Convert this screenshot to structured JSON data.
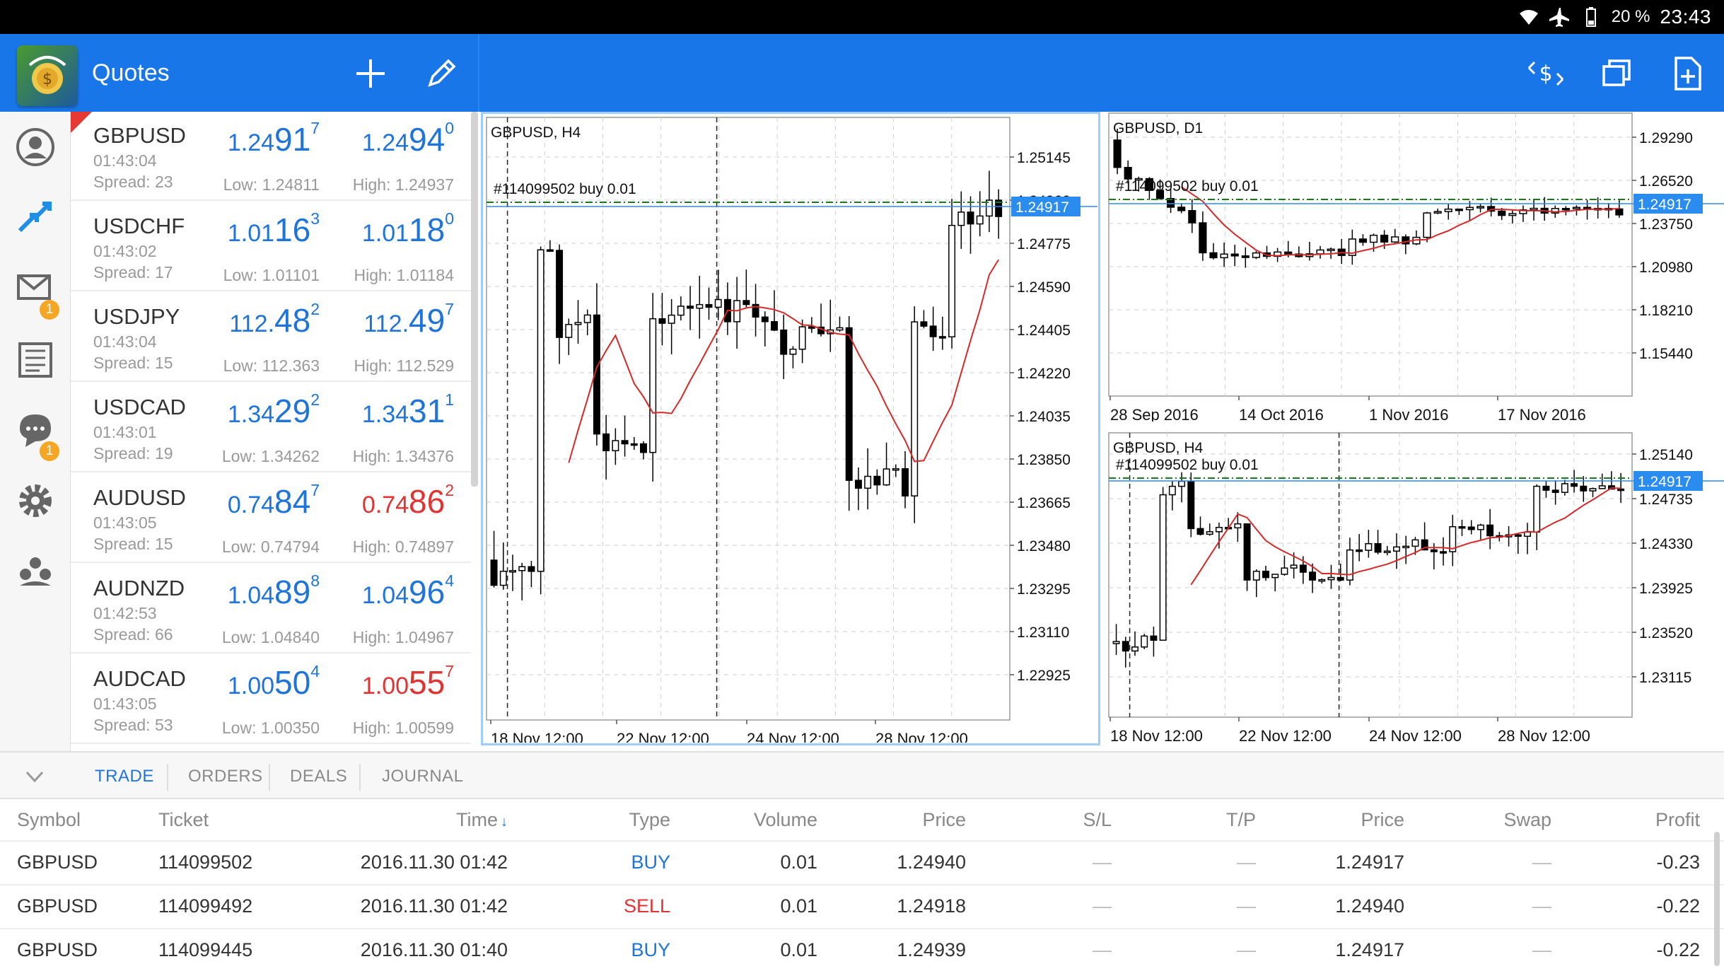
{
  "status_bar": {
    "battery": "20 %",
    "time": "23:43"
  },
  "toolbar": {
    "title": "Quotes"
  },
  "nav": {
    "mail_badge": "1",
    "chat_badge": "1"
  },
  "quotes": [
    {
      "symbol": "GBPUSD",
      "time": "01:43:04",
      "spread": "Spread: 23",
      "bid_a": "1.24",
      "bid_b": "91",
      "bid_c": "7",
      "bid_dir": "up",
      "ask_a": "1.24",
      "ask_b": "94",
      "ask_c": "0",
      "ask_dir": "up",
      "low": "Low: 1.24811",
      "high": "High: 1.24937",
      "flag": true
    },
    {
      "symbol": "USDCHF",
      "time": "01:43:02",
      "spread": "Spread: 17",
      "bid_a": "1.01",
      "bid_b": "16",
      "bid_c": "3",
      "bid_dir": "up",
      "ask_a": "1.01",
      "ask_b": "18",
      "ask_c": "0",
      "ask_dir": "up",
      "low": "Low: 1.01101",
      "high": "High: 1.01184"
    },
    {
      "symbol": "USDJPY",
      "time": "01:43:04",
      "spread": "Spread: 15",
      "bid_a": "112.",
      "bid_b": "48",
      "bid_c": "2",
      "bid_dir": "up",
      "ask_a": "112.",
      "ask_b": "49",
      "ask_c": "7",
      "ask_dir": "up",
      "low": "Low: 112.363",
      "high": "High: 112.529"
    },
    {
      "symbol": "USDCAD",
      "time": "01:43:01",
      "spread": "Spread: 19",
      "bid_a": "1.34",
      "bid_b": "29",
      "bid_c": "2",
      "bid_dir": "up",
      "ask_a": "1.34",
      "ask_b": "31",
      "ask_c": "1",
      "ask_dir": "up",
      "low": "Low: 1.34262",
      "high": "High: 1.34376"
    },
    {
      "symbol": "AUDUSD",
      "time": "01:43:05",
      "spread": "Spread: 15",
      "bid_a": "0.74",
      "bid_b": "84",
      "bid_c": "7",
      "bid_dir": "up",
      "ask_a": "0.74",
      "ask_b": "86",
      "ask_c": "2",
      "ask_dir": "down",
      "low": "Low: 0.74794",
      "high": "High: 0.74897"
    },
    {
      "symbol": "AUDNZD",
      "time": "01:42:53",
      "spread": "Spread: 66",
      "bid_a": "1.04",
      "bid_b": "89",
      "bid_c": "8",
      "bid_dir": "up",
      "ask_a": "1.04",
      "ask_b": "96",
      "ask_c": "4",
      "ask_dir": "up",
      "low": "Low: 1.04840",
      "high": "High: 1.04967"
    },
    {
      "symbol": "AUDCAD",
      "time": "01:43:05",
      "spread": "Spread: 53",
      "bid_a": "1.00",
      "bid_b": "50",
      "bid_c": "4",
      "bid_dir": "up",
      "ask_a": "1.00",
      "ask_b": "55",
      "ask_c": "7",
      "ask_dir": "down",
      "low": "Low: 1.00350",
      "high": "High: 1.00599"
    }
  ],
  "charts": {
    "main": {
      "title": "GBPUSD, H4",
      "trade_label": "#114099502 buy 0.01",
      "price_labels": [
        "1.25145",
        "1.24960",
        "1.24775",
        "1.24590",
        "1.24405",
        "1.24220",
        "1.24035",
        "1.23850",
        "1.23665",
        "1.23480",
        "1.23295",
        "1.23110",
        "1.22925"
      ],
      "current_price": "1.24917",
      "time_labels": [
        "18 Nov 12:00",
        "22 Nov 12:00",
        "24 Nov 12:00",
        "28 Nov 12:00"
      ]
    },
    "d1": {
      "title": "GBPUSD, D1",
      "trade_label": "#114099502 buy 0.01",
      "price_labels": [
        "1.29290",
        "1.26520",
        "1.23750",
        "1.20980",
        "1.18210",
        "1.15440"
      ],
      "current_price": "1.24917",
      "time_labels": [
        "28 Sep 2016",
        "14 Oct 2016",
        "1 Nov 2016",
        "17 Nov 2016"
      ]
    },
    "h4b": {
      "title": "GBPUSD, H4",
      "trade_label": "#114099502 buy 0.01",
      "price_labels": [
        "1.25140",
        "1.24735",
        "1.24330",
        "1.23925",
        "1.23520",
        "1.23115"
      ],
      "current_price": "1.24917",
      "time_labels": [
        "18 Nov 12:00",
        "22 Nov 12:00",
        "24 Nov 12:00",
        "28 Nov 12:00"
      ]
    }
  },
  "tabs": [
    "TRADE",
    "ORDERS",
    "DEALS",
    "JOURNAL"
  ],
  "table": {
    "headers": [
      "Symbol",
      "Ticket",
      "Time",
      "Type",
      "Volume",
      "Price",
      "S/L",
      "T/P",
      "Price",
      "Swap",
      "Profit"
    ],
    "rows": [
      [
        "GBPUSD",
        "114099502",
        "2016.11.30 01:42",
        "BUY",
        "0.01",
        "1.24940",
        "—",
        "—",
        "1.24917",
        "—",
        "-0.23"
      ],
      [
        "GBPUSD",
        "114099492",
        "2016.11.30 01:42",
        "SELL",
        "0.01",
        "1.24918",
        "—",
        "—",
        "1.24940",
        "—",
        "-0.22"
      ],
      [
        "GBPUSD",
        "114099445",
        "2016.11.30 01:40",
        "BUY",
        "0.01",
        "1.24939",
        "—",
        "—",
        "1.24917",
        "—",
        "-0.22"
      ]
    ]
  },
  "colors": {
    "accent": "#1976e8",
    "buy": "#1f74d9",
    "sell": "#e03333",
    "ma_line": "#d62a2a",
    "price_tag": "#2b8cf0"
  }
}
